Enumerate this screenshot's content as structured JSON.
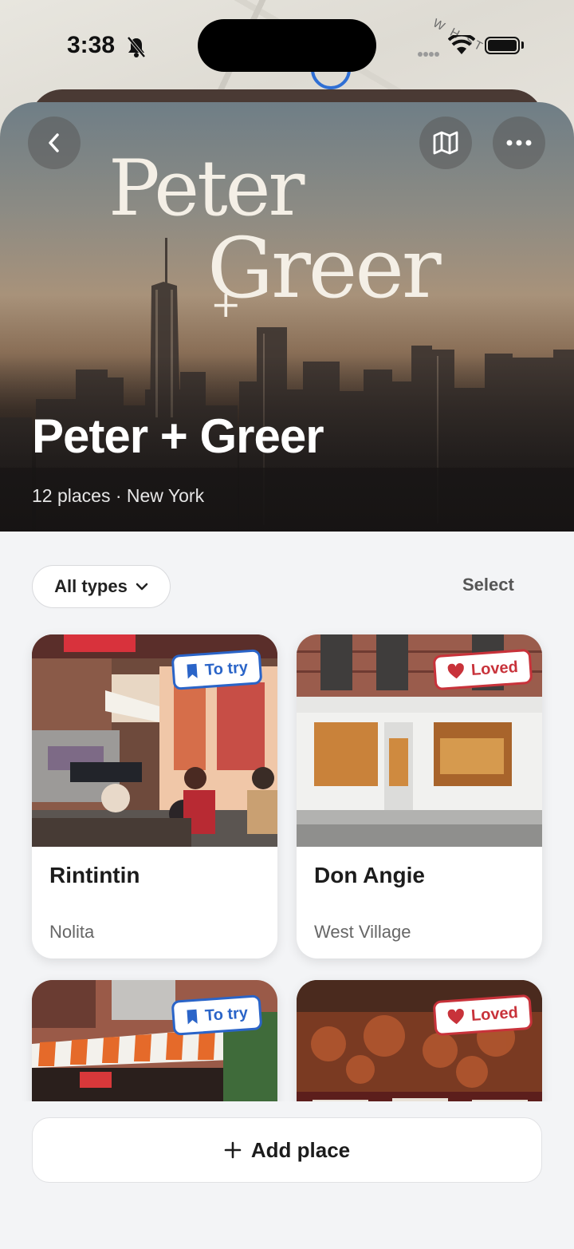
{
  "status": {
    "time": "3:38"
  },
  "map": {
    "street_label": "W H ST"
  },
  "hero": {
    "script_line1": "Peter",
    "script_plus": "+",
    "script_line2": "Greer",
    "title": "Peter + Greer",
    "subtitle": "12 places · New York"
  },
  "controls": {
    "filter_label": "All types",
    "select_label": "Select"
  },
  "places": [
    {
      "name": "Rintintin",
      "neighborhood": "Nolita",
      "badge": "To try"
    },
    {
      "name": "Don Angie",
      "neighborhood": "West Village",
      "badge": "Loved"
    },
    {
      "name": "",
      "neighborhood": "",
      "badge": "To try"
    },
    {
      "name": "",
      "neighborhood": "",
      "badge": "Loved"
    }
  ],
  "footer": {
    "add_label": "Add place"
  },
  "colors": {
    "to_try": "#2a64c8",
    "loved": "#c8323a",
    "background": "#f3f4f6"
  },
  "icons": [
    "back-chevron-icon",
    "map-icon",
    "more-icon",
    "chevron-down-icon",
    "bookmark-icon",
    "heart-icon",
    "plus-icon"
  ]
}
